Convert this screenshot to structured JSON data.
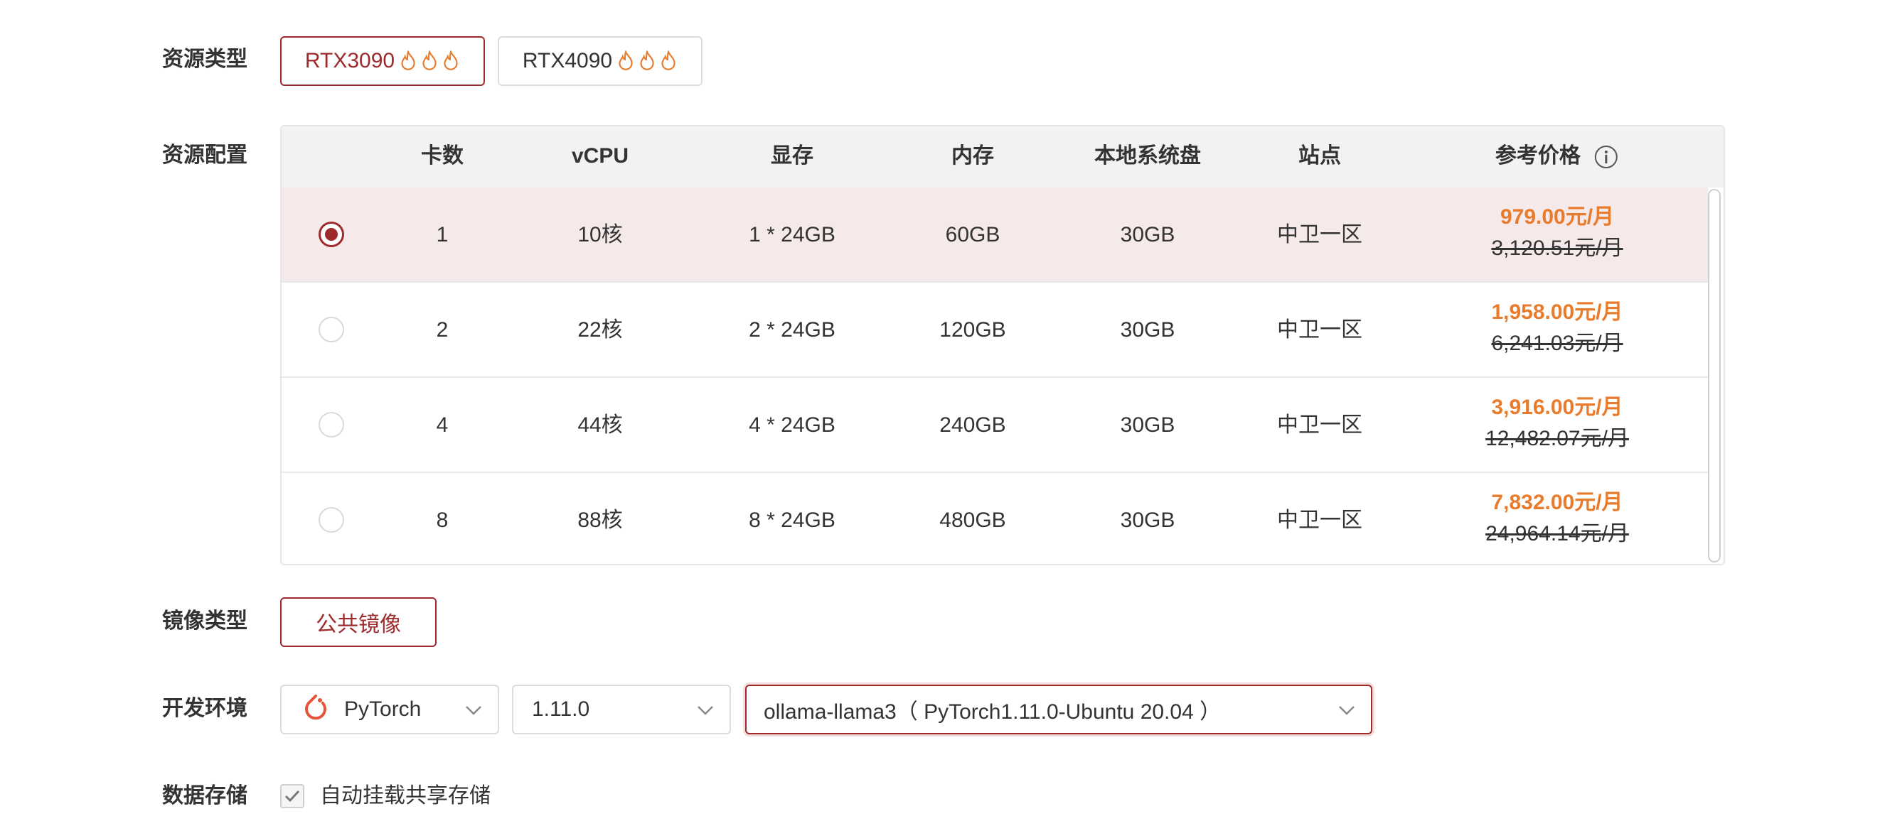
{
  "resource_type": {
    "label": "资源类型",
    "options": [
      {
        "name": "RTX3090",
        "selected": true
      },
      {
        "name": "RTX4090",
        "selected": false
      }
    ],
    "hot_icon": "flame-icon"
  },
  "resource_config": {
    "label": "资源配置",
    "columns": [
      "卡数",
      "vCPU",
      "显存",
      "内存",
      "本地系统盘",
      "站点",
      "参考价格"
    ],
    "price_info_icon": "info-icon",
    "rows": [
      {
        "cards": "1",
        "vcpu": "10核",
        "vram": "1 * 24GB",
        "memory": "60GB",
        "disk": "30GB",
        "site": "中卫一区",
        "price": "979.00元/月",
        "original_price": "3,120.51元/月",
        "selected": true
      },
      {
        "cards": "2",
        "vcpu": "22核",
        "vram": "2 * 24GB",
        "memory": "120GB",
        "disk": "30GB",
        "site": "中卫一区",
        "price": "1,958.00元/月",
        "original_price": "6,241.03元/月",
        "selected": false
      },
      {
        "cards": "4",
        "vcpu": "44核",
        "vram": "4 * 24GB",
        "memory": "240GB",
        "disk": "30GB",
        "site": "中卫一区",
        "price": "3,916.00元/月",
        "original_price": "12,482.07元/月",
        "selected": false
      },
      {
        "cards": "8",
        "vcpu": "88核",
        "vram": "8 * 24GB",
        "memory": "480GB",
        "disk": "30GB",
        "site": "中卫一区",
        "price": "7,832.00元/月",
        "original_price": "24,964.14元/月",
        "selected": false
      }
    ]
  },
  "image_type": {
    "label": "镜像类型",
    "option": "公共镜像"
  },
  "dev_env": {
    "label": "开发环境",
    "framework": "PyTorch",
    "framework_icon": "pytorch-icon",
    "version": "1.11.0",
    "image": "ollama-llama3（ PyTorch1.11.0-Ubuntu 20.04 ）"
  },
  "storage": {
    "label": "数据存储",
    "auto_mount_label": "自动挂载共享存储",
    "auto_mount_checked": true
  },
  "colors": {
    "accent": "#9e2a2b",
    "price": "#e87b2c",
    "selected_row_bg": "#f6e9ea",
    "header_bg": "#f2f2f2"
  }
}
